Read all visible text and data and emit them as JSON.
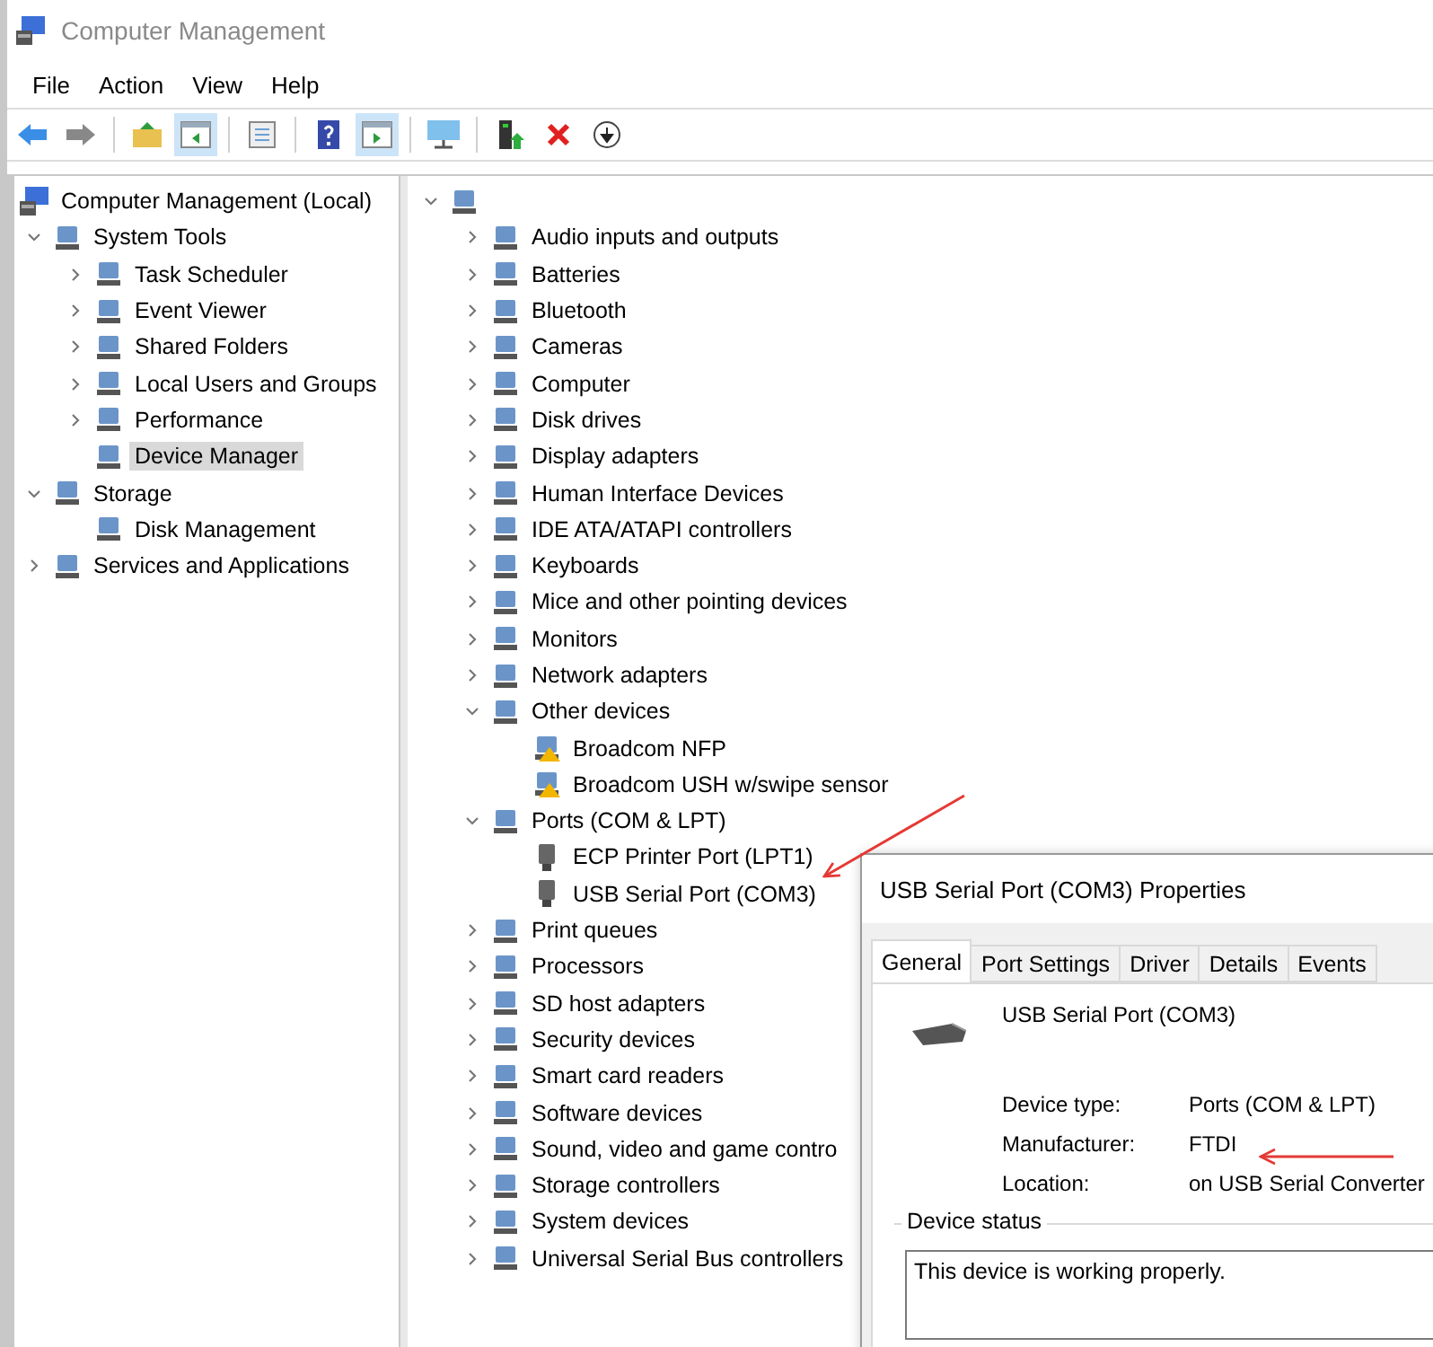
{
  "window": {
    "title": "Computer Management"
  },
  "menu": [
    "File",
    "Action",
    "View",
    "Help"
  ],
  "toolbar": [
    {
      "kind": "back",
      "pressed": false
    },
    {
      "kind": "forward",
      "pressed": false
    },
    {
      "kind": "separator"
    },
    {
      "kind": "up",
      "pressed": false
    },
    {
      "kind": "tree",
      "pressed": true
    },
    {
      "kind": "separator"
    },
    {
      "kind": "list",
      "pressed": false
    },
    {
      "kind": "separator"
    },
    {
      "kind": "help",
      "pressed": false
    },
    {
      "kind": "pane",
      "pressed": true
    },
    {
      "kind": "separator"
    },
    {
      "kind": "monitor",
      "pressed": false
    },
    {
      "kind": "separator"
    },
    {
      "kind": "enable",
      "pressed": false
    },
    {
      "kind": "delete",
      "pressed": false
    },
    {
      "kind": "download",
      "pressed": false
    }
  ],
  "console_tree": [
    {
      "label": "Computer Management (Local)",
      "selected": false,
      "children": [
        {
          "label": "System Tools",
          "expanded": true,
          "selected": false,
          "children": [
            {
              "label": "Task Scheduler",
              "expanded": false,
              "selected": false
            },
            {
              "label": "Event Viewer",
              "expanded": false,
              "selected": false
            },
            {
              "label": "Shared Folders",
              "expanded": false,
              "selected": false
            },
            {
              "label": "Local Users and Groups",
              "expanded": false,
              "selected": false
            },
            {
              "label": "Performance",
              "expanded": false,
              "selected": false
            },
            {
              "label": "Device Manager",
              "selected": true
            }
          ]
        },
        {
          "label": "Storage",
          "expanded": true,
          "selected": false,
          "children": [
            {
              "label": "Disk Management",
              "selected": false
            }
          ]
        },
        {
          "label": "Services and Applications",
          "expanded": false,
          "selected": false
        }
      ]
    }
  ],
  "device_tree": [
    {
      "expanded": true,
      "children": [
        {
          "label": "Audio inputs and outputs",
          "expanded": false
        },
        {
          "label": "Batteries",
          "expanded": false
        },
        {
          "label": "Bluetooth",
          "expanded": false
        },
        {
          "label": "Cameras",
          "expanded": false
        },
        {
          "label": "Computer",
          "expanded": false
        },
        {
          "label": "Disk drives",
          "expanded": false
        },
        {
          "label": "Display adapters",
          "expanded": false
        },
        {
          "label": "Human Interface Devices",
          "expanded": false
        },
        {
          "label": "IDE ATA/ATAPI controllers",
          "expanded": false
        },
        {
          "label": "Keyboards",
          "expanded": false
        },
        {
          "label": "Mice and other pointing devices",
          "expanded": false
        },
        {
          "label": "Monitors",
          "expanded": false
        },
        {
          "label": "Network adapters",
          "expanded": false
        },
        {
          "label": "Other devices",
          "expanded": true,
          "children": [
            {
              "label": "Broadcom NFP",
              "warning": true
            },
            {
              "label": "Broadcom USH w/swipe sensor",
              "warning": true
            }
          ]
        },
        {
          "label": "Ports (COM & LPT)",
          "expanded": true,
          "children": [
            {
              "label": "ECP Printer Port (LPT1)",
              "warning": false
            },
            {
              "label": "USB Serial Port (COM3)",
              "warning": false
            }
          ]
        },
        {
          "label": "Print queues",
          "expanded": false
        },
        {
          "label": "Processors",
          "expanded": false
        },
        {
          "label": "SD host adapters",
          "expanded": false
        },
        {
          "label": "Security devices",
          "expanded": false
        },
        {
          "label": "Smart card readers",
          "expanded": false
        },
        {
          "label": "Software devices",
          "expanded": false
        },
        {
          "label": "Sound, video and game contro",
          "expanded": false
        },
        {
          "label": "Storage controllers",
          "expanded": false
        },
        {
          "label": "System devices",
          "expanded": false
        },
        {
          "label": "Universal Serial Bus controllers",
          "expanded": false
        }
      ]
    }
  ],
  "properties_dialog": {
    "title": "USB Serial Port (COM3) Properties",
    "tabs": [
      {
        "label": "General",
        "selected": true
      },
      {
        "label": "Port Settings",
        "selected": false
      },
      {
        "label": "Driver",
        "selected": false
      },
      {
        "label": "Details",
        "selected": false
      },
      {
        "label": "Events",
        "selected": false
      }
    ],
    "device_name": "USB Serial Port (COM3)",
    "fields": [
      {
        "label": "Device type:",
        "value": "Ports (COM & LPT)"
      },
      {
        "label": "Manufacturer:",
        "value": "FTDI"
      },
      {
        "label": "Location:",
        "value": "on USB Serial Converter"
      }
    ],
    "status_group": "Device status",
    "status_text": "This device is working properly."
  }
}
